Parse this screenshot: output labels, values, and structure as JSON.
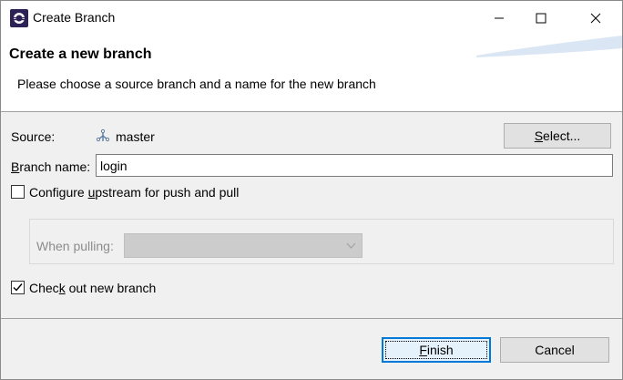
{
  "window": {
    "title": "Create Branch",
    "minimize_glyph": "─",
    "maximize_glyph": "☐",
    "close_glyph": "✕"
  },
  "banner": {
    "title": "Create a new branch",
    "description": "Please choose a source branch and a name for the new branch"
  },
  "source": {
    "label": "Source:",
    "icon": "branch-icon",
    "value": "master",
    "select_button": {
      "pre": "",
      "mnemonic": "S",
      "post": "elect..."
    }
  },
  "branch_name": {
    "label": {
      "pre": "",
      "mnemonic": "B",
      "post": "ranch name:"
    },
    "value": "login"
  },
  "upstream": {
    "checked": false,
    "label": {
      "pre": "Configure ",
      "mnemonic": "u",
      "post": "pstream for push and pull"
    },
    "when_pulling_label": "When pulling:",
    "when_pulling_value": ""
  },
  "checkout": {
    "checked": true,
    "label": {
      "pre": "Chec",
      "mnemonic": "k",
      "post": " out new branch"
    }
  },
  "footer": {
    "finish": {
      "pre": "",
      "mnemonic": "F",
      "post": "inish"
    },
    "cancel": "Cancel"
  },
  "colors": {
    "default_button_border": "#0078d7",
    "disabled_text": "#8c8c8c"
  }
}
